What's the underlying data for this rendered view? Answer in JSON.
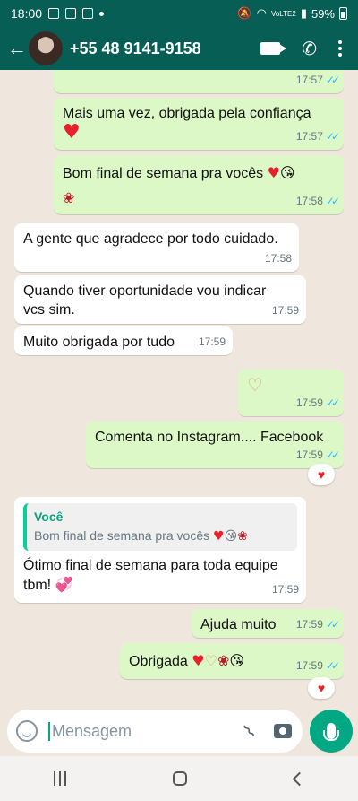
{
  "status": {
    "time": "18:00",
    "battery": "59%",
    "net": "VoLTE2"
  },
  "header": {
    "contact": "+55 48 9141-9158"
  },
  "messages": [
    {
      "time": "17:57"
    },
    {
      "text": "Mais uma vez, obrigada pela confiança",
      "time": "17:57"
    },
    {
      "text": "Bom final de semana pra vocês",
      "time": "17:58"
    },
    {
      "text": "A gente que agradece por todo cuidado.",
      "time": "17:58"
    },
    {
      "line1": "Quando tiver oportunidade vou indicar",
      "line2": "vcs sim.",
      "time": "17:59"
    },
    {
      "text": "Muito obrigada por tudo",
      "time": "17:59"
    },
    {
      "time": "17:59"
    },
    {
      "text": "Comenta no Instagram.... Facebook",
      "time": "17:59"
    },
    {
      "quote_author": "Você",
      "quote_text": "Bom final de semana pra vocês",
      "line1": "Ótimo final de semana para toda equipe",
      "line2": "tbm!",
      "time": "17:59"
    },
    {
      "text": "Ajuda muito",
      "time": "17:59"
    },
    {
      "text": "Obrigada",
      "time": "17:59"
    }
  ],
  "input": {
    "placeholder": "Mensagem"
  },
  "colors": {
    "header": "#075e54",
    "outgoing": "#dcf8c6",
    "incoming": "#ffffff",
    "accent": "#00a884",
    "ticks": "#34b7f1"
  }
}
